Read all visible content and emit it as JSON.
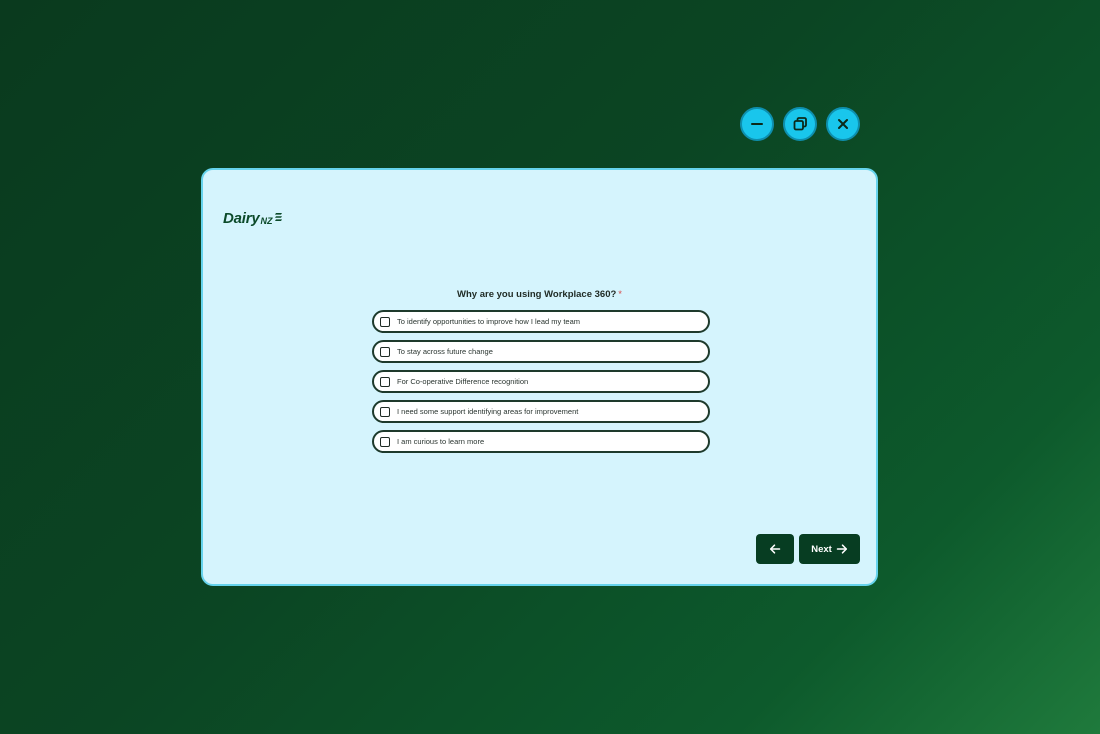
{
  "window": {
    "controls": [
      {
        "name": "minimize",
        "icon": "minus-icon"
      },
      {
        "name": "restore",
        "icon": "restore-icon"
      },
      {
        "name": "close",
        "icon": "close-icon"
      }
    ]
  },
  "brand": {
    "logo_text": "Dairy",
    "logo_suffix": "NZ"
  },
  "form": {
    "question": "Why are you using Workplace 360?",
    "required_marker": "*",
    "options": [
      {
        "label": "To identify opportunities to improve how I lead my team",
        "checked": false
      },
      {
        "label": "To stay across future change",
        "checked": false
      },
      {
        "label": "For Co-operative Difference recognition",
        "checked": false
      },
      {
        "label": "I need some support identifying areas for improvement",
        "checked": false
      },
      {
        "label": "I am curious to learn more",
        "checked": false
      }
    ]
  },
  "nav": {
    "back_icon": "arrow-left-icon",
    "next_label": "Next",
    "next_icon": "arrow-right-icon"
  },
  "colors": {
    "background": "#0b4523",
    "panel": "#d5f4fd",
    "accent": "#19c6ec",
    "primary_button": "#073d22"
  }
}
